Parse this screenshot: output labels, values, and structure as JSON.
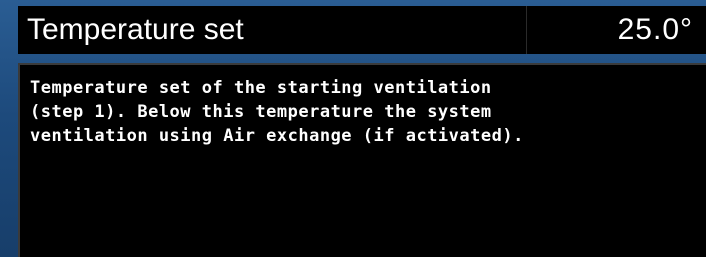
{
  "setting": {
    "title": "Temperature set",
    "value": "25.0°"
  },
  "description": {
    "text": "Temperature set of the starting ventilation\n(step 1). Below this temperature the system\nventilation using Air exchange (if activated)."
  },
  "colors": {
    "background": "#1d4a7c",
    "panel": "#000000",
    "text": "#ffffff"
  }
}
